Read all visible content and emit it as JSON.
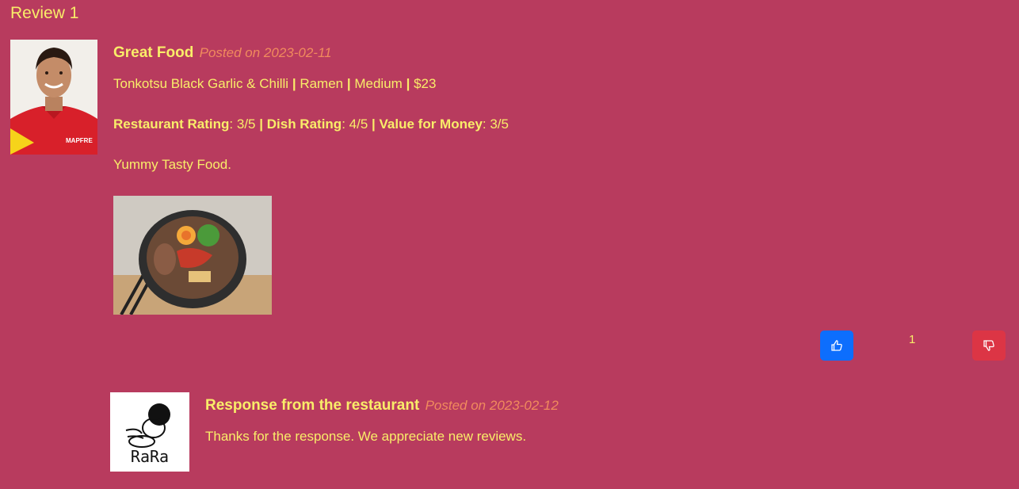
{
  "review": {
    "heading": "Review 1",
    "title": "Great Food",
    "posted": "Posted on 2023-02-11",
    "dish": "Tonkotsu Black Garlic & Chilli",
    "category": "Ramen",
    "size": "Medium",
    "price": "$23",
    "ratings": {
      "restaurant_label": "Restaurant Rating",
      "restaurant_value": ": 3/5",
      "dish_label": "Dish Rating",
      "dish_value": ": 4/5",
      "value_label": "Value for Money",
      "value_value": ": 3/5"
    },
    "comment": "Yummy Tasty Food.",
    "vote_count": "1",
    "avatar_text": "MAPFRE"
  },
  "response": {
    "title": "Response from the restaurant",
    "posted": "Posted on 2023-02-12",
    "text": "Thanks for the response. We appreciate new reviews.",
    "logo_text": "RaRa"
  },
  "colors": {
    "background": "#b83b5e",
    "text": "#f9ed69",
    "date": "#f08a5d",
    "like": "#0d6efd",
    "dislike": "#dc3545"
  },
  "icons": {
    "like": "thumbs-up-icon",
    "dislike": "thumbs-down-icon"
  }
}
